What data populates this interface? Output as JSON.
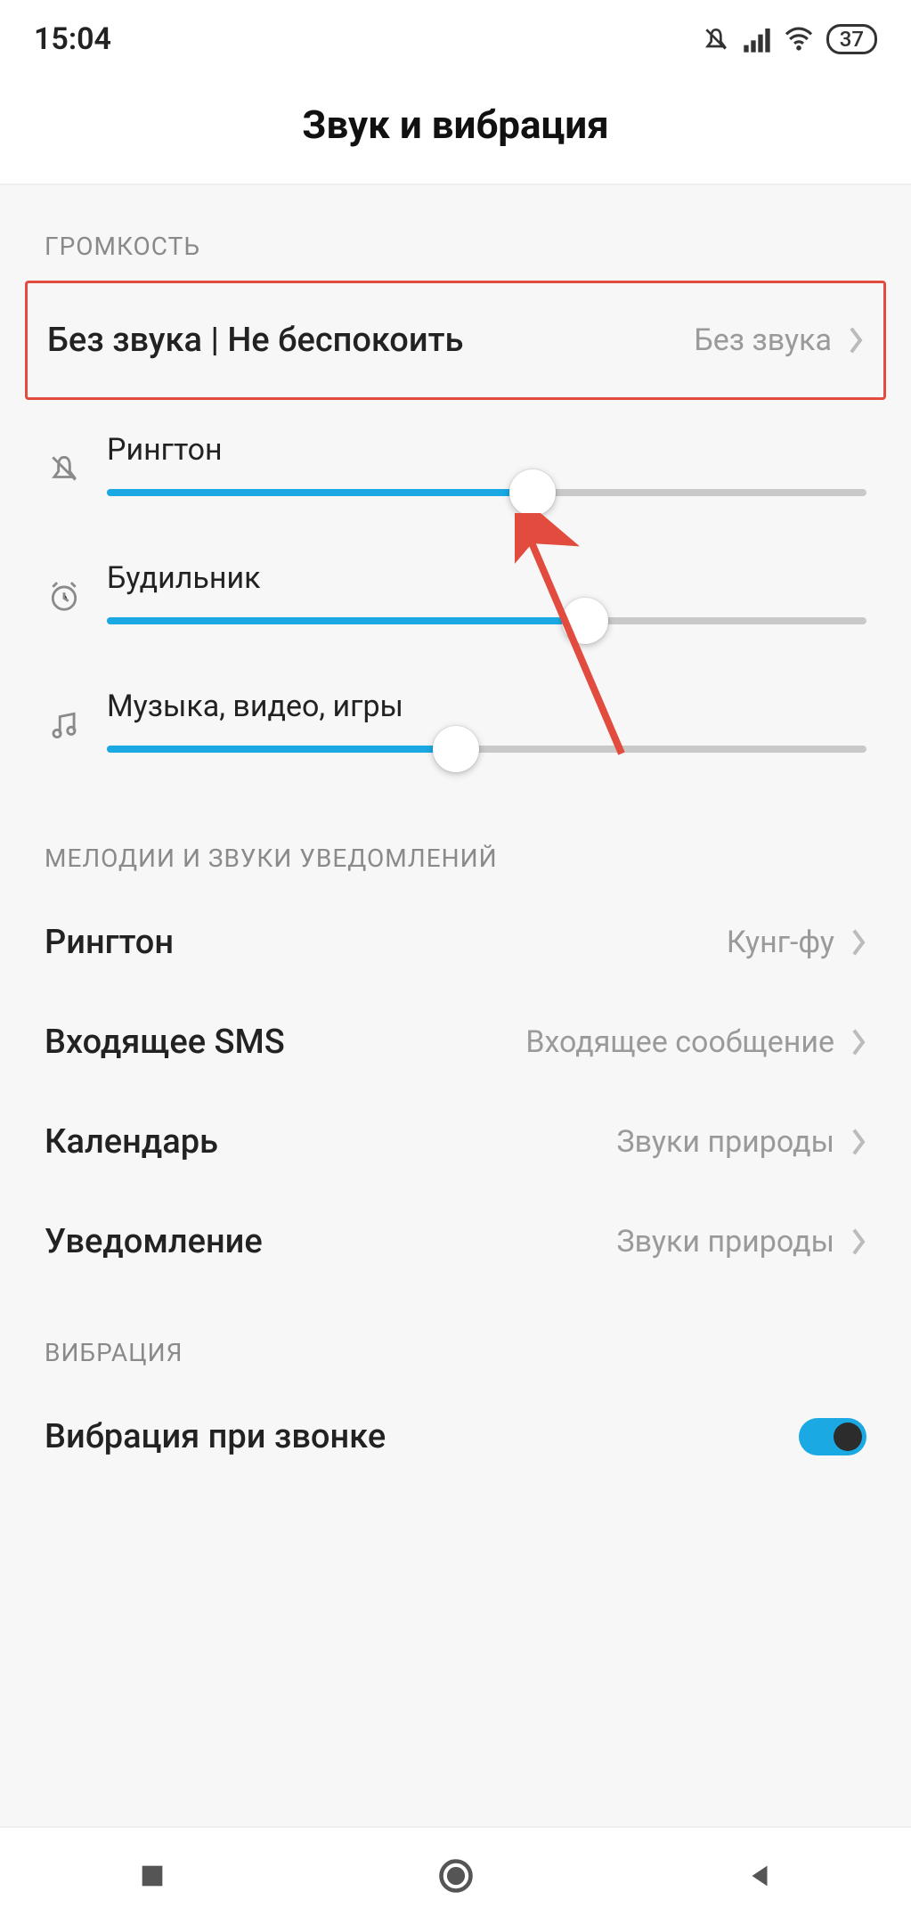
{
  "status": {
    "time": "15:04",
    "battery": "37"
  },
  "header": {
    "title": "Звук и вибрация"
  },
  "sections": {
    "volume": {
      "label": "ГРОМКОСТЬ",
      "silent_row": {
        "label": "Без звука | Не беспокоить",
        "value": "Без звука"
      },
      "sliders": {
        "ringtone": {
          "label": "Рингтон",
          "percent": 56
        },
        "alarm": {
          "label": "Будильник",
          "percent": 63
        },
        "media": {
          "label": "Музыка, видео, игры",
          "percent": 46
        }
      }
    },
    "ringtones": {
      "label": "МЕЛОДИИ И ЗВУКИ УВЕДОМЛЕНИЙ",
      "items": {
        "ringtone": {
          "label": "Рингтон",
          "value": "Кунг-фу"
        },
        "sms": {
          "label": "Входящее SMS",
          "value": "Входящее сообщение"
        },
        "calendar": {
          "label": "Календарь",
          "value": "Звуки природы"
        },
        "notification": {
          "label": "Уведомление",
          "value": "Звуки природы"
        }
      }
    },
    "vibration": {
      "label": "ВИБРАЦИЯ",
      "vibrate_on_call": {
        "label": "Вибрация при звонке",
        "on": true
      }
    }
  },
  "colors": {
    "accent": "#1aa9e3",
    "highlight": "#e24c3f"
  }
}
